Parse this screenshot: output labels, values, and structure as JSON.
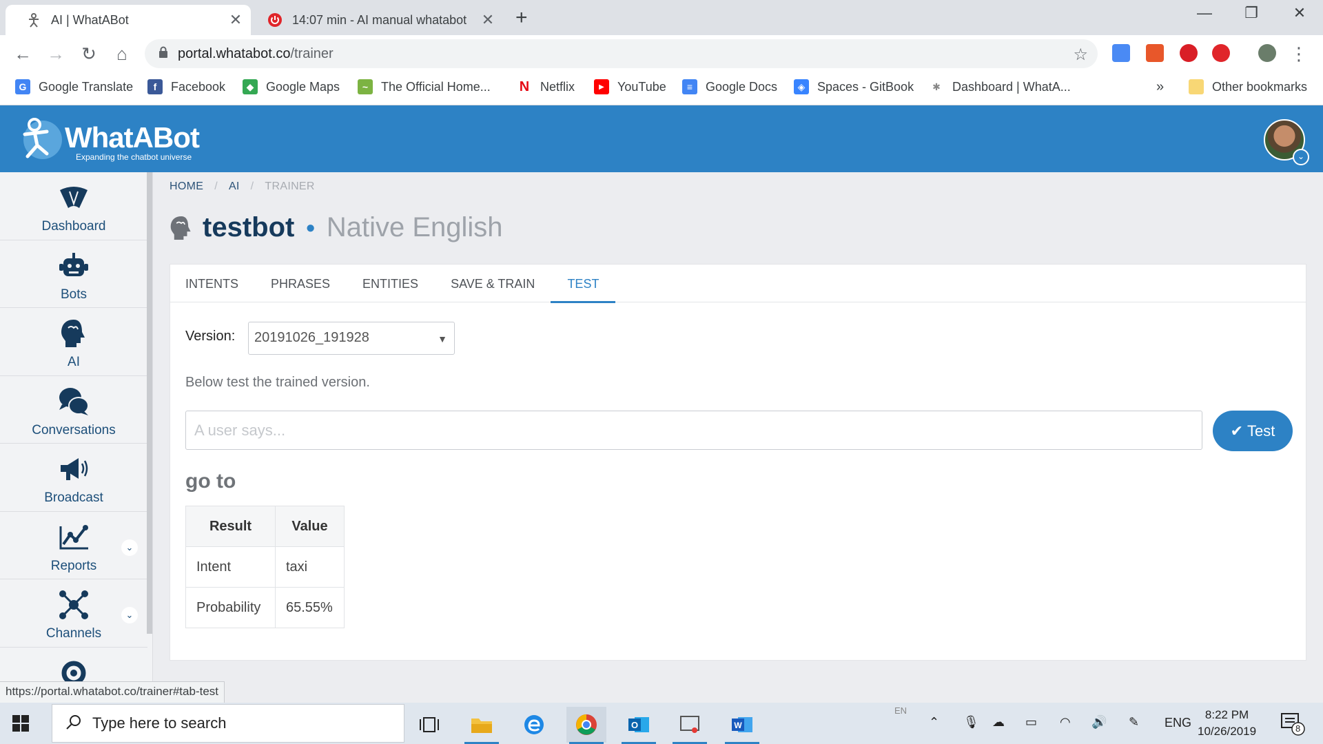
{
  "browser": {
    "tabs": [
      {
        "title": "AI | WhatABot",
        "active": true
      },
      {
        "title": "14:07 min - AI manual whatabot",
        "active": false
      }
    ],
    "url_host": "portal.whatabot.co",
    "url_path": "/trainer",
    "bookmarks": [
      {
        "label": "Google Translate",
        "icon": "google-translate-icon",
        "color": "#4285f4"
      },
      {
        "label": "Facebook",
        "icon": "facebook-icon",
        "color": "#3b5998"
      },
      {
        "label": "Google Maps",
        "icon": "google-maps-icon",
        "color": "#34a853"
      },
      {
        "label": "The Official Home...",
        "icon": "site-icon",
        "color": "#7cb342"
      },
      {
        "label": "Netflix",
        "icon": "netflix-icon",
        "color": "#e50914"
      },
      {
        "label": "YouTube",
        "icon": "youtube-icon",
        "color": "#ff0000"
      },
      {
        "label": "Google Docs",
        "icon": "google-docs-icon",
        "color": "#4285f4"
      },
      {
        "label": "Spaces - GitBook",
        "icon": "gitbook-icon",
        "color": "#3884ff"
      },
      {
        "label": "Dashboard | WhatA...",
        "icon": "whatabot-icon",
        "color": "#888888"
      }
    ],
    "bookmarks_overflow": "»",
    "other_bookmarks": "Other bookmarks",
    "status_url": "https://portal.whatabot.co/trainer#tab-test"
  },
  "app": {
    "brand": "WhatABot",
    "tagline": "Expanding the chatbot universe",
    "accent": "#2d82c5",
    "sidebar": [
      {
        "label": "Dashboard",
        "icon": "dashboard-icon",
        "has_chevron": false
      },
      {
        "label": "Bots",
        "icon": "robot-icon",
        "has_chevron": false
      },
      {
        "label": "AI",
        "icon": "brain-head-icon",
        "has_chevron": false
      },
      {
        "label": "Conversations",
        "icon": "chat-bubbles-icon",
        "has_chevron": false
      },
      {
        "label": "Broadcast",
        "icon": "megaphone-icon",
        "has_chevron": false
      },
      {
        "label": "Reports",
        "icon": "line-chart-icon",
        "has_chevron": true
      },
      {
        "label": "Channels",
        "icon": "network-icon",
        "has_chevron": true
      },
      {
        "label": "",
        "icon": "settings-gear-icon",
        "has_chevron": true
      }
    ],
    "breadcrumb": [
      "HOME",
      "AI",
      "TRAINER"
    ],
    "bot_name": "testbot",
    "bot_language": "Native English",
    "tabs": [
      "INTENTS",
      "PHRASES",
      "ENTITIES",
      "SAVE & TRAIN",
      "TEST"
    ],
    "active_tab": "TEST",
    "version_label": "Version:",
    "version_value": "20191026_191928",
    "hint": "Below test the trained version.",
    "input_placeholder": "A user says...",
    "test_button": "Test",
    "query": "go to",
    "result_table": {
      "headers": [
        "Result",
        "Value"
      ],
      "rows": [
        [
          "Intent",
          "taxi"
        ],
        [
          "Probability",
          "65.55%"
        ]
      ]
    }
  },
  "taskbar": {
    "search_placeholder": "Type here to search",
    "lang": "ENG",
    "time": "8:22 PM",
    "date": "10/26/2019",
    "notifications": "8",
    "ime_hint": "EN"
  }
}
